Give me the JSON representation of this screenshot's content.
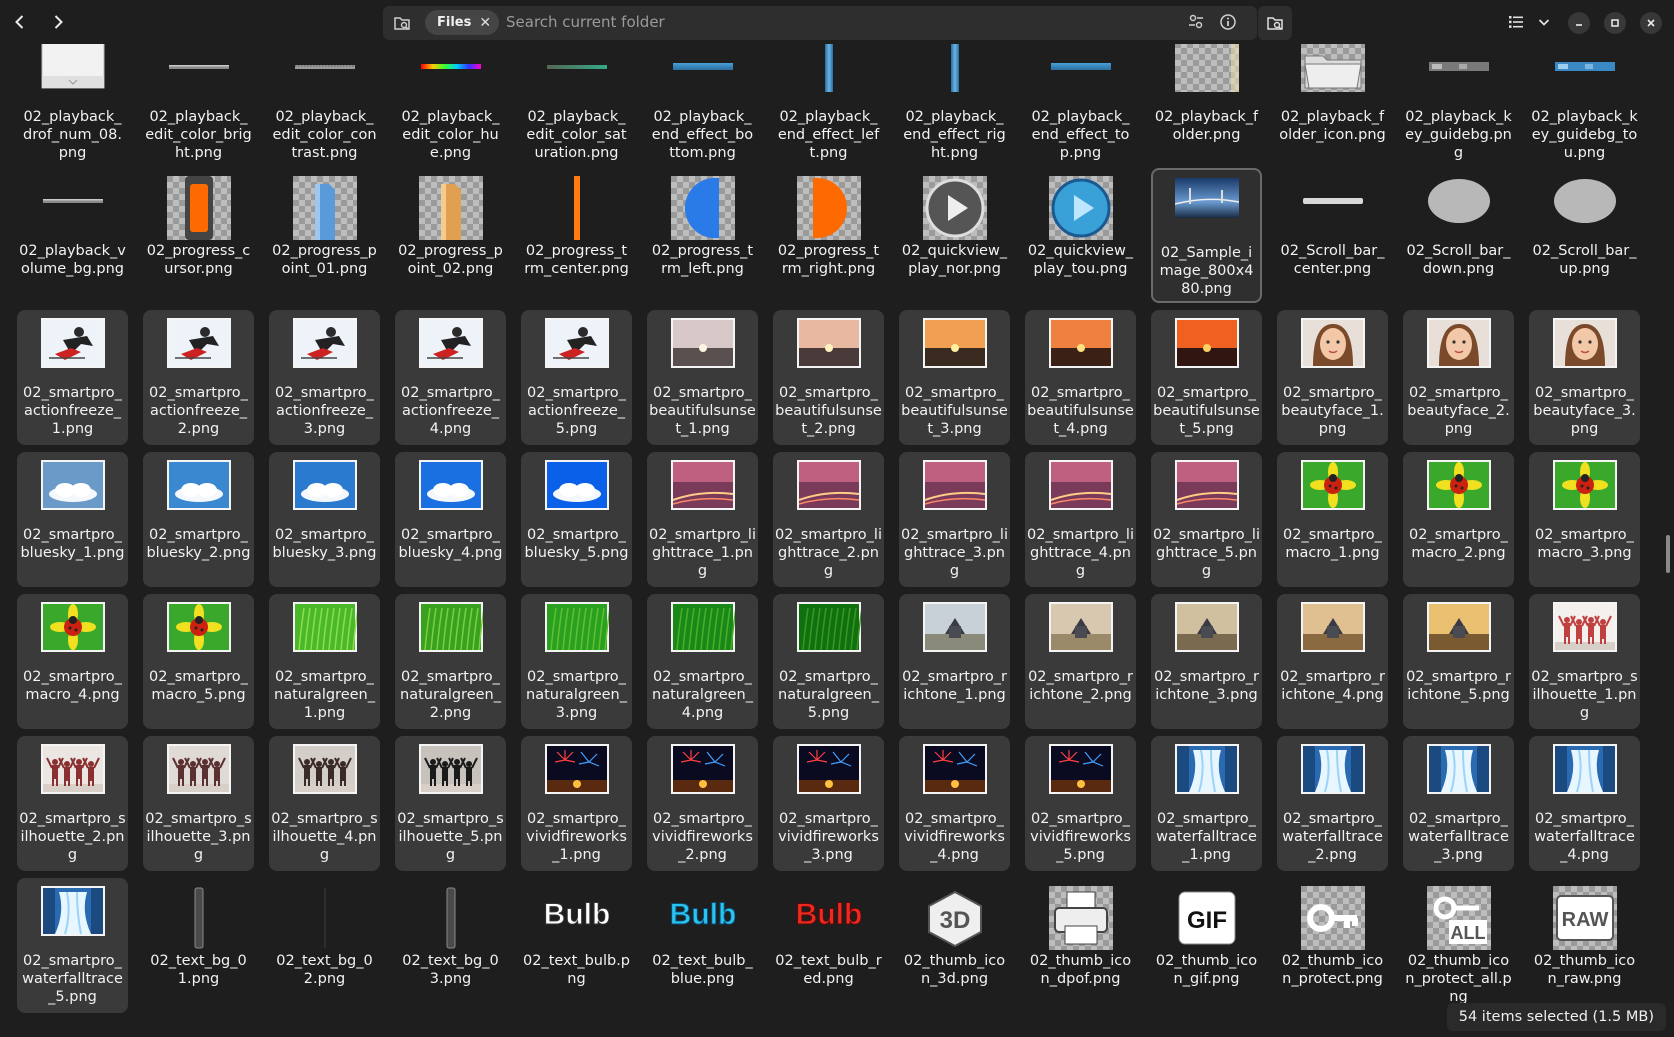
{
  "header": {
    "search_chip": "Files",
    "search_placeholder": "Search current folder"
  },
  "status": "54 items selected  (1.5 MB)",
  "rows": [
    {
      "selected": false,
      "items": [
        {
          "name": "02_playback_drof_num_08.png",
          "thumb": "white-box"
        },
        {
          "name": "02_playback_edit_color_bright.png",
          "thumb": "hbar-gray"
        },
        {
          "name": "02_playback_edit_color_contrast.png",
          "thumb": "hbar-dots"
        },
        {
          "name": "02_playback_edit_color_hue.png",
          "thumb": "hbar-rainbow"
        },
        {
          "name": "02_playback_edit_color_saturation.png",
          "thumb": "hbar-teal"
        },
        {
          "name": "02_playback_end_effect_bottom.png",
          "thumb": "hbar-blue"
        },
        {
          "name": "02_playback_end_effect_left.png",
          "thumb": "vbar-blue"
        },
        {
          "name": "02_playback_end_effect_right.png",
          "thumb": "vbar-blue"
        },
        {
          "name": "02_playback_end_effect_top.png",
          "thumb": "hbar-blue"
        },
        {
          "name": "02_playback_folder.png",
          "thumb": "checker"
        },
        {
          "name": "02_playback_folder_icon.png",
          "thumb": "folder"
        },
        {
          "name": "02_playback_key_guidebg.png",
          "thumb": "keybar-gray"
        },
        {
          "name": "02_playback_key_guidebg_tou.png",
          "thumb": "keybar-blue"
        }
      ]
    },
    {
      "selected": false,
      "items": [
        {
          "name": "02_playback_volume_bg.png",
          "thumb": "hbar-gray"
        },
        {
          "name": "02_progress_cursor.png",
          "thumb": "cursor-orange"
        },
        {
          "name": "02_progress_point_01.png",
          "thumb": "point-blue"
        },
        {
          "name": "02_progress_point_02.png",
          "thumb": "point-tan"
        },
        {
          "name": "02_progress_trm_center.png",
          "thumb": "vline-orange"
        },
        {
          "name": "02_progress_trm_left.png",
          "thumb": "half-blue"
        },
        {
          "name": "02_progress_trm_right.png",
          "thumb": "half-orange"
        },
        {
          "name": "02_quickview_play_nor.png",
          "thumb": "play-gray"
        },
        {
          "name": "02_quickview_play_tou.png",
          "thumb": "play-blue"
        },
        {
          "name": "02_Sample_image_800x480.png",
          "thumb": "sample",
          "current": true
        },
        {
          "name": "02_Scroll_bar_center.png",
          "thumb": "hbar-white"
        },
        {
          "name": "02_Scroll_bar_down.png",
          "thumb": "blob-gray"
        },
        {
          "name": "02_Scroll_bar_up.png",
          "thumb": "blob-gray"
        }
      ]
    },
    {
      "selected": true,
      "items": [
        {
          "name": "02_smartpro_actionfreeze_1.png",
          "thumb": "action"
        },
        {
          "name": "02_smartpro_actionfreeze_2.png",
          "thumb": "action"
        },
        {
          "name": "02_smartpro_actionfreeze_3.png",
          "thumb": "action"
        },
        {
          "name": "02_smartpro_actionfreeze_4.png",
          "thumb": "action"
        },
        {
          "name": "02_smartpro_actionfreeze_5.png",
          "thumb": "action"
        },
        {
          "name": "02_smartpro_beautifulsunset_1.png",
          "thumb": "sunset1"
        },
        {
          "name": "02_smartpro_beautifulsunset_2.png",
          "thumb": "sunset2"
        },
        {
          "name": "02_smartpro_beautifulsunset_3.png",
          "thumb": "sunset3"
        },
        {
          "name": "02_smartpro_beautifulsunset_4.png",
          "thumb": "sunset4"
        },
        {
          "name": "02_smartpro_beautifulsunset_5.png",
          "thumb": "sunset5"
        },
        {
          "name": "02_smartpro_beautyface_1.png",
          "thumb": "face"
        },
        {
          "name": "02_smartpro_beautyface_2.png",
          "thumb": "face"
        },
        {
          "name": "02_smartpro_beautyface_3.png",
          "thumb": "face"
        }
      ]
    },
    {
      "selected": true,
      "items": [
        {
          "name": "02_smartpro_bluesky_1.png",
          "thumb": "sky1"
        },
        {
          "name": "02_smartpro_bluesky_2.png",
          "thumb": "sky2"
        },
        {
          "name": "02_smartpro_bluesky_3.png",
          "thumb": "sky3"
        },
        {
          "name": "02_smartpro_bluesky_4.png",
          "thumb": "sky4"
        },
        {
          "name": "02_smartpro_bluesky_5.png",
          "thumb": "sky5"
        },
        {
          "name": "02_smartpro_lighttrace_1.png",
          "thumb": "trace"
        },
        {
          "name": "02_smartpro_lighttrace_2.png",
          "thumb": "trace"
        },
        {
          "name": "02_smartpro_lighttrace_3.png",
          "thumb": "trace"
        },
        {
          "name": "02_smartpro_lighttrace_4.png",
          "thumb": "trace"
        },
        {
          "name": "02_smartpro_lighttrace_5.png",
          "thumb": "trace"
        },
        {
          "name": "02_smartpro_macro_1.png",
          "thumb": "macro"
        },
        {
          "name": "02_smartpro_macro_2.png",
          "thumb": "macro"
        },
        {
          "name": "02_smartpro_macro_3.png",
          "thumb": "macro"
        }
      ]
    },
    {
      "selected": true,
      "items": [
        {
          "name": "02_smartpro_macro_4.png",
          "thumb": "macro"
        },
        {
          "name": "02_smartpro_macro_5.png",
          "thumb": "macro"
        },
        {
          "name": "02_smartpro_naturalgreen_1.png",
          "thumb": "green1"
        },
        {
          "name": "02_smartpro_naturalgreen_2.png",
          "thumb": "green2"
        },
        {
          "name": "02_smartpro_naturalgreen_3.png",
          "thumb": "green3"
        },
        {
          "name": "02_smartpro_naturalgreen_4.png",
          "thumb": "green4"
        },
        {
          "name": "02_smartpro_naturalgreen_5.png",
          "thumb": "green5"
        },
        {
          "name": "02_smartpro_richtone_1.png",
          "thumb": "rich1"
        },
        {
          "name": "02_smartpro_richtone_2.png",
          "thumb": "rich2"
        },
        {
          "name": "02_smartpro_richtone_3.png",
          "thumb": "rich3"
        },
        {
          "name": "02_smartpro_richtone_4.png",
          "thumb": "rich4"
        },
        {
          "name": "02_smartpro_richtone_5.png",
          "thumb": "rich5"
        },
        {
          "name": "02_smartpro_silhouette_1.png",
          "thumb": "silh1"
        }
      ]
    },
    {
      "selected": true,
      "items": [
        {
          "name": "02_smartpro_silhouette_2.png",
          "thumb": "silh2"
        },
        {
          "name": "02_smartpro_silhouette_3.png",
          "thumb": "silh3"
        },
        {
          "name": "02_smartpro_silhouette_4.png",
          "thumb": "silh4"
        },
        {
          "name": "02_smartpro_silhouette_5.png",
          "thumb": "silh5"
        },
        {
          "name": "02_smartpro_vividfireworks_1.png",
          "thumb": "fire"
        },
        {
          "name": "02_smartpro_vividfireworks_2.png",
          "thumb": "fire"
        },
        {
          "name": "02_smartpro_vividfireworks_3.png",
          "thumb": "fire"
        },
        {
          "name": "02_smartpro_vividfireworks_4.png",
          "thumb": "fire"
        },
        {
          "name": "02_smartpro_vividfireworks_5.png",
          "thumb": "fire"
        },
        {
          "name": "02_smartpro_waterfalltrace_1.png",
          "thumb": "water"
        },
        {
          "name": "02_smartpro_waterfalltrace_2.png",
          "thumb": "water"
        },
        {
          "name": "02_smartpro_waterfalltrace_3.png",
          "thumb": "water"
        },
        {
          "name": "02_smartpro_waterfalltrace_4.png",
          "thumb": "water"
        }
      ]
    },
    {
      "selected": false,
      "items": [
        {
          "name": "02_smartpro_waterfalltrace_5.png",
          "thumb": "water",
          "selected": true
        },
        {
          "name": "02_text_bg_01.png",
          "thumb": "vbar-dark"
        },
        {
          "name": "02_text_bg_02.png",
          "thumb": "vbar-thin"
        },
        {
          "name": "02_text_bg_03.png",
          "thumb": "vbar-dark"
        },
        {
          "name": "02_text_bulb.png",
          "thumb": "bulb-white"
        },
        {
          "name": "02_text_bulb_blue.png",
          "thumb": "bulb-blue"
        },
        {
          "name": "02_text_bulb_red.png",
          "thumb": "bulb-red"
        },
        {
          "name": "02_thumb_icon_3d.png",
          "thumb": "icon-3d"
        },
        {
          "name": "02_thumb_icon_dpof.png",
          "thumb": "icon-printer"
        },
        {
          "name": "02_thumb_icon_gif.png",
          "thumb": "icon-gif"
        },
        {
          "name": "02_thumb_icon_protect.png",
          "thumb": "icon-key"
        },
        {
          "name": "02_thumb_icon_protect_all.png",
          "thumb": "icon-keyall"
        },
        {
          "name": "02_thumb_icon_raw.png",
          "thumb": "icon-raw"
        }
      ]
    }
  ]
}
